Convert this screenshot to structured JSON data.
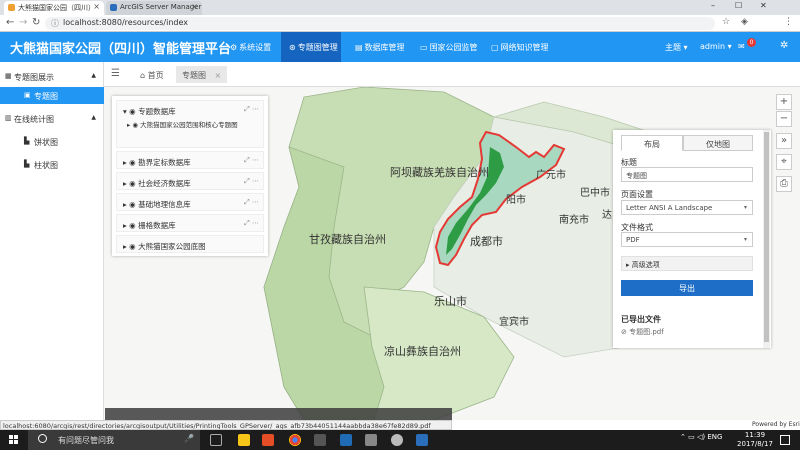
{
  "browser": {
    "tabs": [
      {
        "title": "大熊猫国家公园（四川）",
        "active": true
      },
      {
        "title": "ArcGIS Server Manager",
        "active": false
      }
    ],
    "url": "localhost:8080/resources/index",
    "window_controls": [
      "–",
      "☐",
      "✕"
    ]
  },
  "header": {
    "title": "大熊猫国家公园（四川）智能管理平台",
    "nav": [
      {
        "icon": "gear-icon",
        "label": "系统设置",
        "active": false
      },
      {
        "icon": "map-icon",
        "label": "专题图管理",
        "active": true
      },
      {
        "icon": "database-icon",
        "label": "数据库管理",
        "active": false
      },
      {
        "icon": "monitor-icon",
        "label": "国家公园监管",
        "active": false
      },
      {
        "icon": "screen-icon",
        "label": "网络知识管理",
        "active": false
      }
    ],
    "theme_label": "主题",
    "user_label": "admin",
    "mail_badge": "0"
  },
  "sidebar": {
    "items": [
      {
        "label": "专题图展示",
        "level": 0,
        "selected": false
      },
      {
        "label": "专题图",
        "level": 1,
        "selected": true
      },
      {
        "label": "在线统计图",
        "level": 0,
        "selected": false
      },
      {
        "label": "饼状图",
        "level": 1,
        "selected": false
      },
      {
        "label": "柱状图",
        "level": 1,
        "selected": false
      }
    ]
  },
  "content_tabs": [
    {
      "label": "首页",
      "active": false
    },
    {
      "label": "专题图",
      "active": true
    }
  ],
  "layers": {
    "items": [
      {
        "label": "专题数据库",
        "expanded": true
      },
      {
        "label": "大熊猫国家公园范围和核心专题图",
        "child": true
      },
      {
        "label": "勘界定标数据库"
      },
      {
        "label": "社会经济数据库"
      },
      {
        "label": "基础地理信息库"
      },
      {
        "label": "栅格数据库"
      },
      {
        "label": "大熊猫国家公园底图"
      }
    ]
  },
  "print": {
    "tab_layout": "布局",
    "tab_map_only": "仅地图",
    "title_label": "标题",
    "title_value": "专题图",
    "page_label": "页面设置",
    "page_value": "Letter ANSI A Landscape",
    "format_label": "文件格式",
    "format_value": "PDF",
    "advanced_label": "高级选项",
    "export_button": "导出",
    "exported_label": "已导出文件",
    "exported_file": "专题图.pdf"
  },
  "map": {
    "view_label": "3D",
    "labels": {
      "aba": "阿坝藏族羌族自治州",
      "ganzi": "甘孜藏族自治州",
      "liangshan": "凉山彝族自治州",
      "chengdu": "成都市",
      "leshan": "乐山市",
      "yibin": "宜宾市",
      "guangyuan": "广元市",
      "bazhong": "巴中市",
      "nanchong": "南充市",
      "mianyang": "阳市",
      "dazhou": "达"
    },
    "colors": {
      "plateau": "#c7ddb3",
      "basin": "#e8eee5",
      "park_fill": "#2e9c44",
      "park_outline": "#e53935",
      "accent": "#2196f3"
    }
  },
  "status_url": "localhost:6080/arcgis/rest/directories/arcgisoutput/Utilities/PrintingTools_GPServer/_ags_afb73b44051144aabbda38e67fe82d89.pdf",
  "powered_by": "Powered by Esri",
  "taskbar": {
    "search_placeholder": "有问题尽管问我",
    "tray_text": "ENG",
    "time": "11:39",
    "date": "2017/8/17"
  }
}
